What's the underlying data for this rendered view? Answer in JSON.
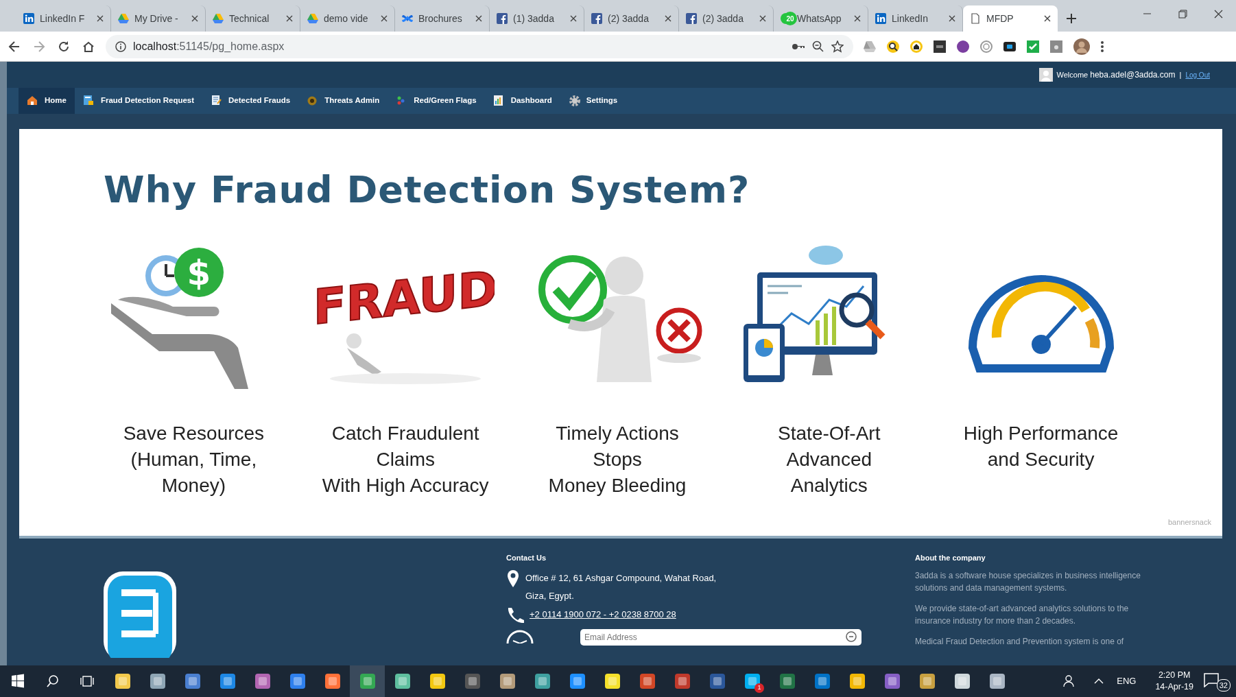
{
  "browser": {
    "tabs": [
      {
        "title": "LinkedIn F",
        "kind": "linkedin",
        "selected": false
      },
      {
        "title": "My Drive -",
        "kind": "drive",
        "selected": false
      },
      {
        "title": "Technical",
        "kind": "drive",
        "selected": false
      },
      {
        "title": "demo vide",
        "kind": "drive",
        "selected": false
      },
      {
        "title": "Brochures",
        "kind": "confluence",
        "selected": false
      },
      {
        "title": "(1) 3adda",
        "kind": "facebook",
        "selected": false
      },
      {
        "title": "(2) 3adda",
        "kind": "facebook",
        "selected": false
      },
      {
        "title": "(2) 3adda",
        "kind": "facebook",
        "selected": false
      },
      {
        "title": "WhatsApp",
        "kind": "whatsapp",
        "badge": "20",
        "selected": false
      },
      {
        "title": "LinkedIn",
        "kind": "linkedin",
        "selected": false
      },
      {
        "title": "MFDP",
        "kind": "page",
        "selected": true
      }
    ],
    "url_host": "localhost",
    "url_path": ":51145/pg_home.aspx"
  },
  "header": {
    "welcome": "Welcome",
    "user": "heba.adel@3adda.com",
    "separator": "|",
    "logout": "Log Out"
  },
  "menu": [
    {
      "label": "Home",
      "kind": "home",
      "selected": true
    },
    {
      "label": "Fraud Detection Request",
      "kind": "request",
      "selected": false
    },
    {
      "label": "Detected Frauds",
      "kind": "list",
      "selected": false
    },
    {
      "label": "Threats Admin",
      "kind": "threat",
      "selected": false
    },
    {
      "label": "Red/Green Flags",
      "kind": "flags",
      "selected": false
    },
    {
      "label": "Dashboard",
      "kind": "dashboard",
      "selected": false
    },
    {
      "label": "Settings",
      "kind": "settings",
      "selected": false
    }
  ],
  "banner": {
    "title": "Why Fraud Detection System?",
    "credit": "bannersnack",
    "features": [
      {
        "kind": "resources",
        "symbol": "$",
        "caption": [
          "Save Resources",
          "(Human, Time,",
          "Money)"
        ]
      },
      {
        "kind": "fraud",
        "word": "FRAUD",
        "caption": [
          "Catch Fraudulent",
          "Claims",
          "With High Accuracy"
        ]
      },
      {
        "kind": "actions",
        "caption": [
          "Timely Actions",
          "Stops",
          "Money Bleeding"
        ]
      },
      {
        "kind": "analytics",
        "caption": [
          "State-Of-Art",
          "Advanced",
          "Analytics"
        ]
      },
      {
        "kind": "performance",
        "caption": [
          "High Performance",
          "and Security"
        ]
      }
    ]
  },
  "footer": {
    "contact_title": "Contact Us",
    "address": [
      "Office # 12, 61 Ashgar Compound, Wahat Road,",
      "Giza, Egypt."
    ],
    "phone": "+2 0114 1900 072 - +2 0238 8700 28",
    "email_placeholder": "Email Address",
    "about_title": "About the company",
    "about": [
      "3adda is a software house specializes in business intelligence solutions and data management systems.",
      "We provide state-of-art advanced analytics solutions to the insurance industry for more than 2 decades.",
      "Medical Fraud Detection and Prevention system is one of"
    ]
  },
  "taskbar": {
    "apps": [
      {
        "kind": "explorer",
        "selected": false
      },
      {
        "kind": "notes",
        "selected": false
      },
      {
        "kind": "network",
        "selected": false
      },
      {
        "kind": "edge",
        "selected": false
      },
      {
        "kind": "paint",
        "selected": false
      },
      {
        "kind": "store",
        "selected": false
      },
      {
        "kind": "firefox",
        "selected": false
      },
      {
        "kind": "chrome",
        "selected": true
      },
      {
        "kind": "plane",
        "selected": false
      },
      {
        "kind": "powerbi",
        "selected": false
      },
      {
        "kind": "camera",
        "selected": false
      },
      {
        "kind": "image",
        "selected": false
      },
      {
        "kind": "globe",
        "selected": false
      },
      {
        "kind": "ie",
        "selected": false
      },
      {
        "kind": "sticky",
        "selected": false
      },
      {
        "kind": "powerpoint",
        "selected": false
      },
      {
        "kind": "chart",
        "selected": false
      },
      {
        "kind": "word",
        "selected": false
      },
      {
        "kind": "skype",
        "badge": "1",
        "selected": false
      },
      {
        "kind": "excel",
        "selected": false
      },
      {
        "kind": "outlook",
        "selected": false
      },
      {
        "kind": "check",
        "selected": false
      },
      {
        "kind": "vs",
        "selected": false
      },
      {
        "kind": "tools",
        "selected": false
      },
      {
        "kind": "gear",
        "selected": false
      },
      {
        "kind": "brush",
        "selected": false
      }
    ],
    "language": "ENG",
    "time": "2:20 PM",
    "date": "14-Apr-19",
    "notifications": "32"
  }
}
